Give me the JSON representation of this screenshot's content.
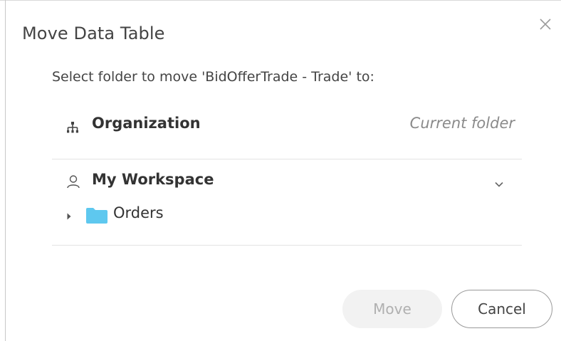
{
  "dialog": {
    "title": "Move Data Table",
    "close_icon": "close-icon",
    "subtitle": "Select folder to move 'BidOfferTrade - Trade' to:"
  },
  "folders": {
    "organization": {
      "icon": "hierarchy-icon",
      "label": "Organization",
      "note": "Current folder"
    },
    "workspace": {
      "icon": "user-icon",
      "label": "My Workspace",
      "toggle_icon": "chevron-down-icon"
    },
    "children": [
      {
        "icon": "folder-icon",
        "expand_icon": "caret-right-icon",
        "label": "Orders"
      }
    ]
  },
  "buttons": {
    "move_label": "Move",
    "cancel_label": "Cancel"
  },
  "colors": {
    "folder": "#5ec8ef",
    "disabled_button_bg": "#f2f2f2",
    "disabled_button_text": "#b0b0b0"
  }
}
